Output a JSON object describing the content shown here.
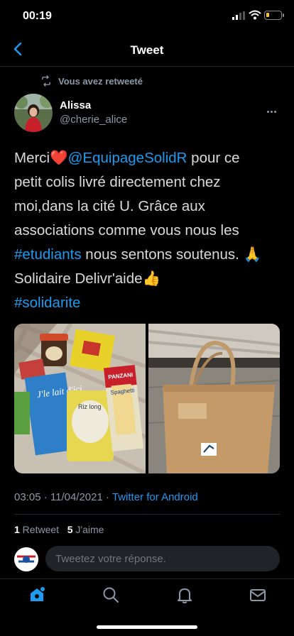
{
  "status_bar": {
    "time": "00:19",
    "battery_level": 0.2
  },
  "header": {
    "title": "Tweet"
  },
  "retweet_notice": "Vous avez retweeté",
  "author": {
    "name": "Alissa",
    "handle": "@cherie_alice"
  },
  "tweet": {
    "line1_prefix": "Merci❤️",
    "mention": "@EquipageSolidR",
    "line1_suffix": " pour ce",
    "line2": "petit colis livré directement chez",
    "line3": "moi,dans la cité U. Grâce aux",
    "line4": "associations comme vous nous les",
    "hashtag1": "#etudiants",
    "line5_suffix": " nous sentons soutenus. 🙏",
    "line6": "Solidaire Delivr'aide👍",
    "hashtag2": "#solidarite"
  },
  "media": {
    "left_image": "photo-groceries",
    "right_image": "photo-paper-bag",
    "labels": {
      "lait": "J'le lait d'ici",
      "panzani": "PANZANI",
      "spaghetti": "Spaghetti",
      "riz": "Riz long"
    }
  },
  "meta": {
    "timestamp": "03:05 · 11/04/2021 · ",
    "source": "Twitter for Android"
  },
  "stats": {
    "retweets_count": "1",
    "retweets_label": " Retweet",
    "likes_count": "5",
    "likes_label": " J'aime"
  },
  "reply": {
    "placeholder": "Tweetez votre réponse."
  },
  "tabs": [
    "home-icon",
    "search-icon",
    "bell-icon",
    "mail-icon"
  ],
  "colors": {
    "accent": "#1d9bf0",
    "background": "#000000",
    "muted": "#8b98a5"
  }
}
